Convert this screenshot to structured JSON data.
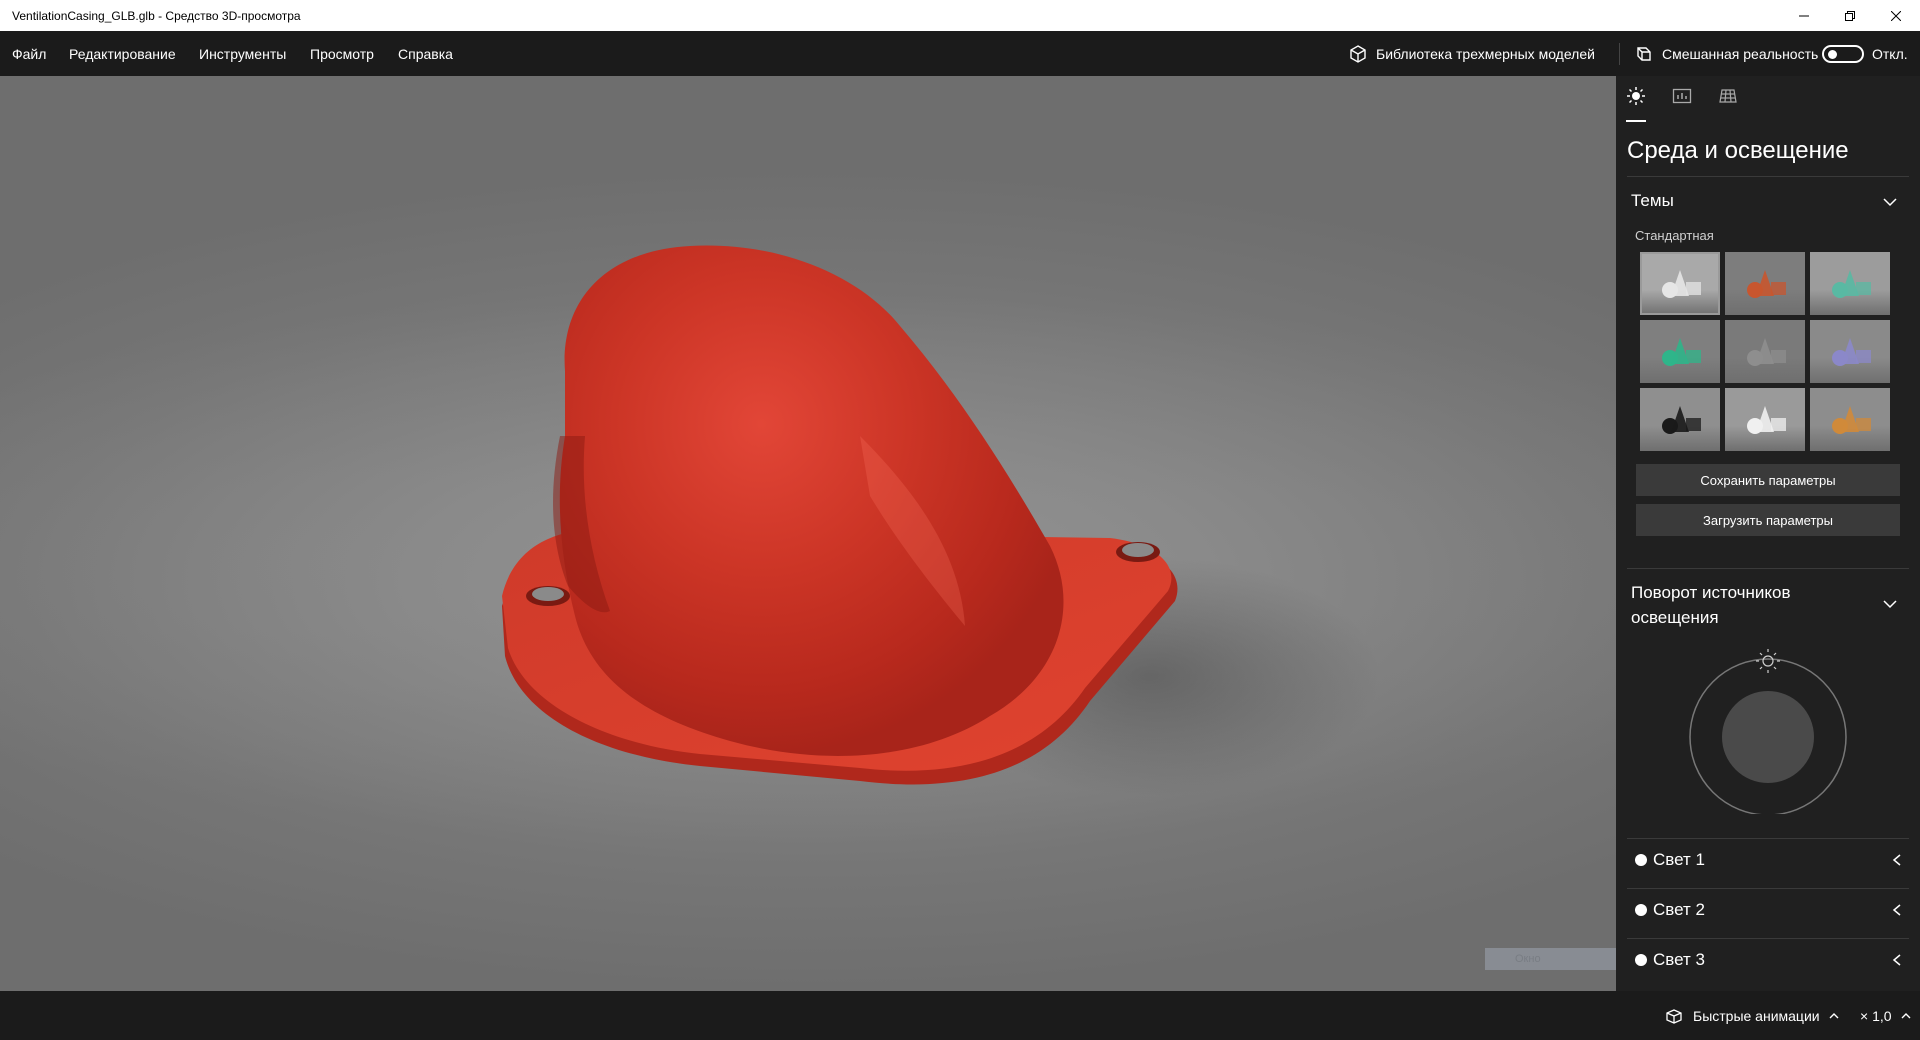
{
  "window": {
    "title": "VentilationCasing_GLB.glb - Средство 3D-просмотра"
  },
  "menu": {
    "items": [
      "Файл",
      "Редактирование",
      "Инструменты",
      "Просмотр",
      "Справка"
    ],
    "library_label": "Библиотека трехмерных моделей",
    "mixed_reality_label": "Смешанная реальность",
    "mixed_reality_state": "Откл."
  },
  "viewport": {
    "overlay_text": "Окно",
    "model_color": "#d93a2b"
  },
  "panel": {
    "tabs": [
      "sun-icon",
      "stats-icon",
      "grid-icon"
    ],
    "title": "Среда и освещение",
    "themes_section": "Темы",
    "themes_sublabel": "Стандартная",
    "themes": [
      {
        "name": "light-gray",
        "bg": "#a9a9a9",
        "fg": "#e6e6e6"
      },
      {
        "name": "dark-orange",
        "bg": "#7d7d7d",
        "fg": "#c8562f"
      },
      {
        "name": "teal",
        "bg": "#9c9c9c",
        "fg": "#59b9a3"
      },
      {
        "name": "green",
        "bg": "#7f7f7f",
        "fg": "#2fb58a"
      },
      {
        "name": "gray-dark",
        "bg": "#7a7a7a",
        "fg": "#8e8e8e"
      },
      {
        "name": "lavender",
        "bg": "#8a8a8a",
        "fg": "#8b88c9"
      },
      {
        "name": "black",
        "bg": "#8f8f8f",
        "fg": "#1a1a1a"
      },
      {
        "name": "white",
        "bg": "#9a9a9a",
        "fg": "#f0f0f0"
      },
      {
        "name": "purple-orange",
        "bg": "#8d8d8d",
        "fg": "#d08a3a"
      }
    ],
    "save_button": "Сохранить параметры",
    "load_button": "Загрузить параметры",
    "rotation_section": "Поворот источников освещения",
    "lights": [
      "Свет 1",
      "Свет 2",
      "Свет 3"
    ]
  },
  "bottom": {
    "quick_animations": "Быстрые анимации",
    "speed": "× 1,0"
  }
}
